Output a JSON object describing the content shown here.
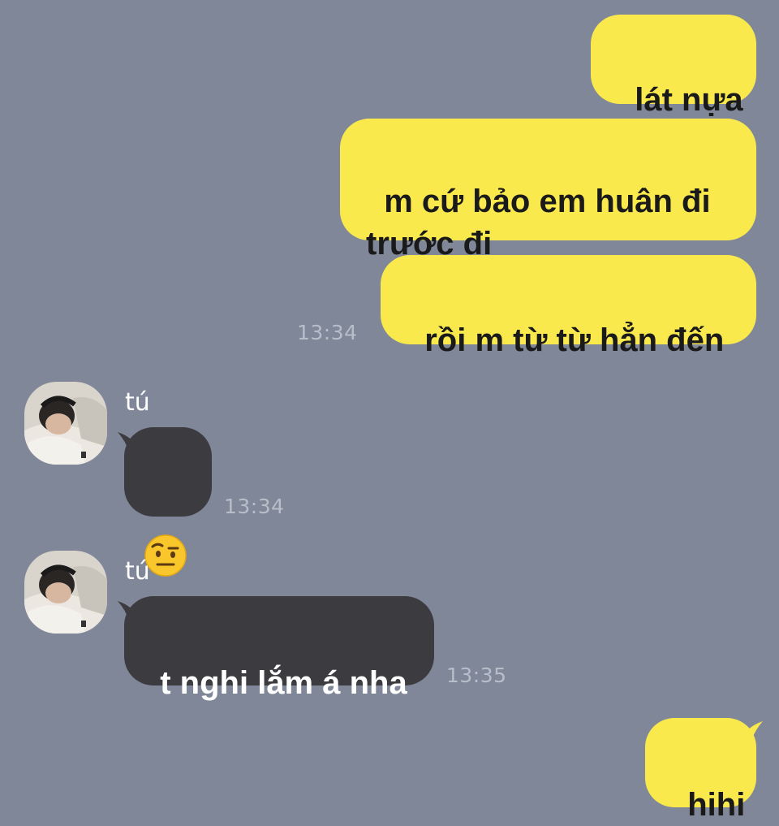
{
  "colors": {
    "background": "#7f8798",
    "outgoing_bubble": "#fae94d",
    "incoming_bubble": "#3c3c40",
    "timestamp": "#b8bec9"
  },
  "messages": {
    "out_1": {
      "text": "lát nựa"
    },
    "out_2": {
      "text": "m cứ bảo em huân đi\ntrước đi"
    },
    "out_3": {
      "text": "rồi m từ từ hẳn đến",
      "time": "13:34"
    },
    "in_1": {
      "sender": "tú",
      "emoji": "face-with-raised-eyebrow-icon",
      "time": "13:34"
    },
    "in_2": {
      "sender": "tú",
      "text": "t nghi lắm á nha",
      "time": "13:35"
    },
    "out_4": {
      "text": "hihi"
    }
  }
}
